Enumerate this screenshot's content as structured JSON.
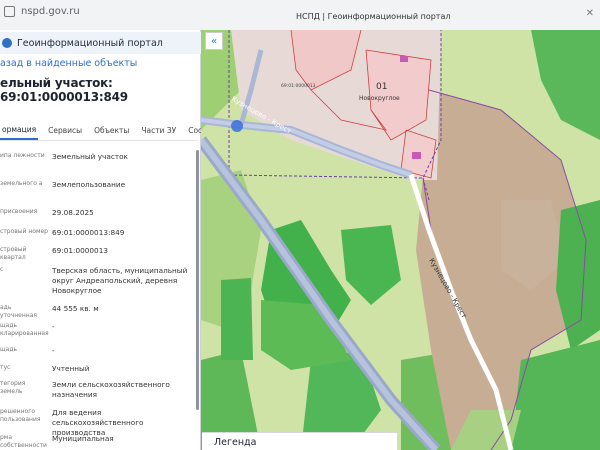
{
  "browser": {
    "url": "nspd.gov.ru",
    "tab_title": "НСПД | Геоинформационный портал"
  },
  "panel": {
    "portal_title": "Геоинформационный портал",
    "back_link": "азад в найденные объекты",
    "parcel_title": "ельный участок: 69:01:0000013:849",
    "tabs": [
      "ормация",
      "Сервисы",
      "Объекты",
      "Части ЗУ",
      "Соств"
    ],
    "rows": [
      {
        "label": "ипа\nлежности",
        "value": "Земельный участок"
      },
      {
        "label": "земельного\nа",
        "value": "Землепользование"
      },
      {
        "label": "присвоения",
        "value": "29.08.2025"
      },
      {
        "label": "стровый номер",
        "value": "69:01:0000013:849"
      },
      {
        "label": "стровый квартал",
        "value": "69:01:0000013"
      },
      {
        "label": "с",
        "value": "Тверская область, муниципальный округ Андреапольский, деревня Новокруглое"
      },
      {
        "label": "адь уточненная",
        "value": "44 555 кв. м"
      },
      {
        "label": "щадь\nкларированная",
        "value": "-"
      },
      {
        "label": "щадь",
        "value": "-"
      },
      {
        "label": "тус",
        "value": "Учтенный"
      },
      {
        "label": "тегория земель",
        "value": "Земли сельскохозяйственного назначения"
      },
      {
        "label": "решенного\nпользования",
        "value": "Для ведения сельскохозяйственного производства"
      },
      {
        "label": "рма собственности",
        "value": "Муниципальная"
      }
    ]
  },
  "map": {
    "collapse_icon": "«",
    "village_label": "Новокруглое",
    "village_code": "01",
    "road_label_1": "Кузнецово - Крест",
    "road_label_2": "Кузнецово - Крест",
    "cadastral_code": "69:01:0000013",
    "legend_title": "Легенда"
  }
}
